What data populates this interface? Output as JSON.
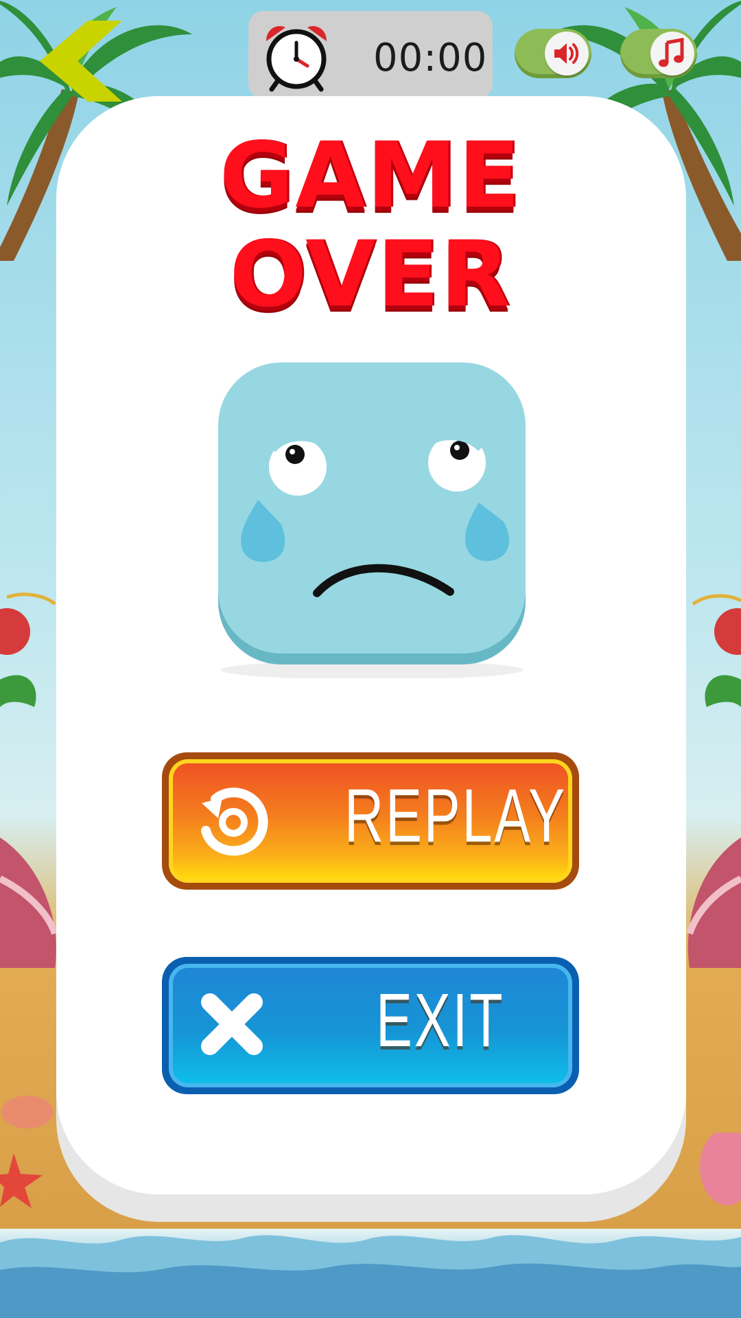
{
  "header": {
    "back_icon": "chevron-left-icon",
    "timer": {
      "icon": "alarm-clock-icon",
      "value": "00:00"
    },
    "sound_toggle": {
      "icon": "speaker-icon",
      "on": true
    },
    "music_toggle": {
      "icon": "music-note-icon",
      "on": true
    }
  },
  "dialog": {
    "title_line1": "GAME",
    "title_line2": "OVER",
    "face_icon": "crying-face-icon",
    "replay_button": {
      "label": "REPLAY",
      "icon": "replay-icon"
    },
    "exit_button": {
      "label": "EXIT",
      "icon": "close-icon"
    }
  },
  "colors": {
    "title_red": "#ff0f1c",
    "replay_orange": "#f47d1d",
    "exit_blue": "#1695d5",
    "toggle_green": "#8dbc56",
    "face_blue": "#97d7e2"
  }
}
